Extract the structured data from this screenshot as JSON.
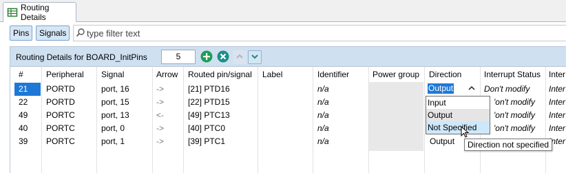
{
  "tab": {
    "label": "Routing Details",
    "icon": "routing-table-icon"
  },
  "toolbar": {
    "pins_label": "Pins",
    "signals_label": "Signals",
    "filter_placeholder": "type filter text",
    "filter_value": ""
  },
  "panel": {
    "title": "Routing Details for BOARD_InitPins",
    "count": "5",
    "buttons": [
      "add-icon",
      "remove-icon",
      "move-up-icon",
      "move-down-icon"
    ]
  },
  "columns": [
    "#",
    "Peripheral",
    "Signal",
    "Arrow",
    "Routed pin/signal",
    "Label",
    "Identifier",
    "Power group",
    "Direction",
    "Interrupt Status",
    "Inter"
  ],
  "rows": [
    {
      "num": "21",
      "peripheral": "PORTD",
      "signal": "port, 16",
      "arrow": "->",
      "routed": "[21] PTD16",
      "label": "",
      "identifier": "n/a",
      "direction": "Output",
      "interrupt": "Don't modify",
      "inter": "Inter"
    },
    {
      "num": "22",
      "peripheral": "PORTD",
      "signal": "port, 15",
      "arrow": "->",
      "routed": "[22] PTD15",
      "label": "",
      "identifier": "n/a",
      "direction": "",
      "interrupt": "'on't modify",
      "inter": "Inter"
    },
    {
      "num": "49",
      "peripheral": "PORTC",
      "signal": "port, 13",
      "arrow": "<-",
      "routed": "[49] PTC13",
      "label": "",
      "identifier": "n/a",
      "direction": "",
      "interrupt": "'on't modify",
      "inter": "Inter"
    },
    {
      "num": "40",
      "peripheral": "PORTC",
      "signal": "port, 0",
      "arrow": "->",
      "routed": "[40] PTC0",
      "label": "",
      "identifier": "n/a",
      "direction": "",
      "interrupt": "'on't modify",
      "inter": "Inter"
    },
    {
      "num": "39",
      "peripheral": "PORTC",
      "signal": "port, 1",
      "arrow": "->",
      "routed": "[39] PTC1",
      "label": "",
      "identifier": "n/a",
      "direction": "Output",
      "interrupt": "",
      "inter": "Inter"
    }
  ],
  "dropdown": {
    "selected": "Output",
    "options": [
      "Input",
      "Output",
      "Not Specified"
    ]
  },
  "tooltip": "Direction not specified",
  "colors": {
    "accent": "#1e78d6",
    "header_bg": "#cfe0f1",
    "add_green": "#1f9d55",
    "remove_teal": "#1d8f86"
  }
}
